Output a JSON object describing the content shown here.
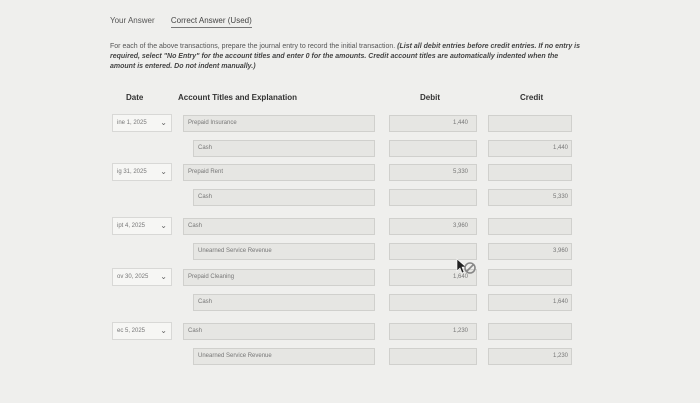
{
  "tabs": [
    "Your Answer",
    "Correct Answer (Used)"
  ],
  "instructions": {
    "text": "For each of the above transactions, prepare the journal entry to record the initial transaction. ",
    "italic": "(List all debit entries before credit entries. If no entry is required, select \"No Entry\" for the account titles and enter 0 for the amounts. Credit account titles are automatically indented when the amount is entered. Do not indent manually.)"
  },
  "headers": {
    "date": "Date",
    "account": "Account Titles and Explanation",
    "debit": "Debit",
    "credit": "Credit"
  },
  "entries": [
    {
      "date": "ine 1, 2025",
      "debit_account": "Prepaid Insurance",
      "debit": "1,440",
      "credit_account": "Cash",
      "credit": "1,440"
    },
    {
      "date": "ig 31, 2025",
      "debit_account": "Prepaid Rent",
      "debit": "5,330",
      "credit_account": "Cash",
      "credit": "5,330"
    },
    {
      "date": "ipt 4, 2025",
      "debit_account": "Cash",
      "debit": "3,960",
      "credit_account": "Unearned Service Revenue",
      "credit": "3,960"
    },
    {
      "date": "ov 30, 2025",
      "debit_account": "Prepaid Cleaning",
      "debit": "1,640",
      "credit_account": "Cash",
      "credit": "1,640"
    },
    {
      "date": "ec 5, 2025",
      "debit_account": "Cash",
      "debit": "1,230",
      "credit_account": "Unearned Service Revenue",
      "credit": "1,230"
    }
  ]
}
